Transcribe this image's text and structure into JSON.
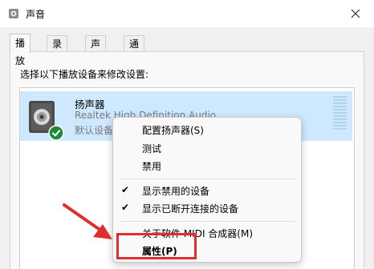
{
  "window": {
    "title": "声音"
  },
  "tabs": [
    "播放",
    "录制",
    "声音",
    "通信"
  ],
  "instruction": "选择以下播放设备来修改设置:",
  "device": {
    "name": "扬声器",
    "description": "Realtek High Definition Audio",
    "status": "默认设备"
  },
  "context_menu": {
    "items": [
      {
        "label": "配置扬声器(S)"
      },
      {
        "label": "测试"
      },
      {
        "label": "禁用"
      },
      {
        "label": "显示禁用的设备",
        "checked": true
      },
      {
        "label": "显示已断开连接的设备",
        "checked": true
      },
      {
        "label": "关于软件 MIDI 合成器(M)"
      },
      {
        "label": "属性(P)"
      }
    ],
    "check_mark": "✔"
  },
  "annotation": {
    "color": "#e02d2d"
  }
}
